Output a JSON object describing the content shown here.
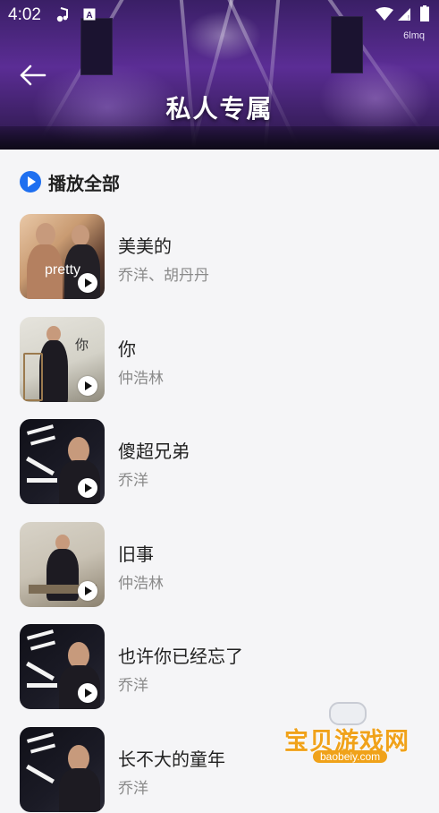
{
  "status_bar": {
    "time": "4:02",
    "network_label": "6lmq",
    "icons": [
      "music-note-icon",
      "a-letter-icon",
      "wifi-icon",
      "signal-icon",
      "battery-icon"
    ]
  },
  "header": {
    "title": "私人专属",
    "back_icon": "back-arrow-icon"
  },
  "play_all": {
    "label": "播放全部",
    "icon": "play-circle-icon",
    "accent": "#1e6ff0"
  },
  "songs": [
    {
      "title": "美美的",
      "artist": "乔洋、胡丹丹",
      "cover_text": "pretty"
    },
    {
      "title": "你",
      "artist": "仲浩林",
      "cover_text": "你"
    },
    {
      "title": "傻超兄弟",
      "artist": "乔洋",
      "cover_text": ""
    },
    {
      "title": "旧事",
      "artist": "仲浩林",
      "cover_text": ""
    },
    {
      "title": "也许你已经忘了",
      "artist": "乔洋",
      "cover_text": ""
    },
    {
      "title": "长不大的童年",
      "artist": "乔洋",
      "cover_text": ""
    }
  ],
  "watermark": {
    "text": "宝贝游戏网",
    "url": "baobeiy.com"
  }
}
